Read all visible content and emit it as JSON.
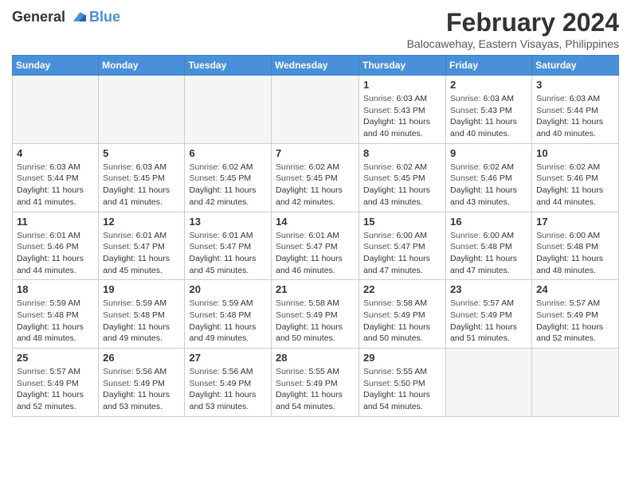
{
  "header": {
    "logo_general": "General",
    "logo_blue": "Blue",
    "month": "February 2024",
    "location": "Balocawehay, Eastern Visayas, Philippines"
  },
  "columns": [
    "Sunday",
    "Monday",
    "Tuesday",
    "Wednesday",
    "Thursday",
    "Friday",
    "Saturday"
  ],
  "weeks": [
    {
      "days": [
        {
          "num": "",
          "empty": true
        },
        {
          "num": "",
          "empty": true
        },
        {
          "num": "",
          "empty": true
        },
        {
          "num": "",
          "empty": true
        },
        {
          "num": "1",
          "sunrise": "6:03 AM",
          "sunset": "5:43 PM",
          "daylight": "11 hours and 40 minutes."
        },
        {
          "num": "2",
          "sunrise": "6:03 AM",
          "sunset": "5:43 PM",
          "daylight": "11 hours and 40 minutes."
        },
        {
          "num": "3",
          "sunrise": "6:03 AM",
          "sunset": "5:44 PM",
          "daylight": "11 hours and 40 minutes."
        }
      ]
    },
    {
      "days": [
        {
          "num": "4",
          "sunrise": "6:03 AM",
          "sunset": "5:44 PM",
          "daylight": "11 hours and 41 minutes."
        },
        {
          "num": "5",
          "sunrise": "6:03 AM",
          "sunset": "5:45 PM",
          "daylight": "11 hours and 41 minutes."
        },
        {
          "num": "6",
          "sunrise": "6:02 AM",
          "sunset": "5:45 PM",
          "daylight": "11 hours and 42 minutes."
        },
        {
          "num": "7",
          "sunrise": "6:02 AM",
          "sunset": "5:45 PM",
          "daylight": "11 hours and 42 minutes."
        },
        {
          "num": "8",
          "sunrise": "6:02 AM",
          "sunset": "5:45 PM",
          "daylight": "11 hours and 43 minutes."
        },
        {
          "num": "9",
          "sunrise": "6:02 AM",
          "sunset": "5:46 PM",
          "daylight": "11 hours and 43 minutes."
        },
        {
          "num": "10",
          "sunrise": "6:02 AM",
          "sunset": "5:46 PM",
          "daylight": "11 hours and 44 minutes."
        }
      ]
    },
    {
      "days": [
        {
          "num": "11",
          "sunrise": "6:01 AM",
          "sunset": "5:46 PM",
          "daylight": "11 hours and 44 minutes."
        },
        {
          "num": "12",
          "sunrise": "6:01 AM",
          "sunset": "5:47 PM",
          "daylight": "11 hours and 45 minutes."
        },
        {
          "num": "13",
          "sunrise": "6:01 AM",
          "sunset": "5:47 PM",
          "daylight": "11 hours and 45 minutes."
        },
        {
          "num": "14",
          "sunrise": "6:01 AM",
          "sunset": "5:47 PM",
          "daylight": "11 hours and 46 minutes."
        },
        {
          "num": "15",
          "sunrise": "6:00 AM",
          "sunset": "5:47 PM",
          "daylight": "11 hours and 47 minutes."
        },
        {
          "num": "16",
          "sunrise": "6:00 AM",
          "sunset": "5:48 PM",
          "daylight": "11 hours and 47 minutes."
        },
        {
          "num": "17",
          "sunrise": "6:00 AM",
          "sunset": "5:48 PM",
          "daylight": "11 hours and 48 minutes."
        }
      ]
    },
    {
      "days": [
        {
          "num": "18",
          "sunrise": "5:59 AM",
          "sunset": "5:48 PM",
          "daylight": "11 hours and 48 minutes."
        },
        {
          "num": "19",
          "sunrise": "5:59 AM",
          "sunset": "5:48 PM",
          "daylight": "11 hours and 49 minutes."
        },
        {
          "num": "20",
          "sunrise": "5:59 AM",
          "sunset": "5:48 PM",
          "daylight": "11 hours and 49 minutes."
        },
        {
          "num": "21",
          "sunrise": "5:58 AM",
          "sunset": "5:49 PM",
          "daylight": "11 hours and 50 minutes."
        },
        {
          "num": "22",
          "sunrise": "5:58 AM",
          "sunset": "5:49 PM",
          "daylight": "11 hours and 50 minutes."
        },
        {
          "num": "23",
          "sunrise": "5:57 AM",
          "sunset": "5:49 PM",
          "daylight": "11 hours and 51 minutes."
        },
        {
          "num": "24",
          "sunrise": "5:57 AM",
          "sunset": "5:49 PM",
          "daylight": "11 hours and 52 minutes."
        }
      ]
    },
    {
      "days": [
        {
          "num": "25",
          "sunrise": "5:57 AM",
          "sunset": "5:49 PM",
          "daylight": "11 hours and 52 minutes."
        },
        {
          "num": "26",
          "sunrise": "5:56 AM",
          "sunset": "5:49 PM",
          "daylight": "11 hours and 53 minutes."
        },
        {
          "num": "27",
          "sunrise": "5:56 AM",
          "sunset": "5:49 PM",
          "daylight": "11 hours and 53 minutes."
        },
        {
          "num": "28",
          "sunrise": "5:55 AM",
          "sunset": "5:49 PM",
          "daylight": "11 hours and 54 minutes."
        },
        {
          "num": "29",
          "sunrise": "5:55 AM",
          "sunset": "5:50 PM",
          "daylight": "11 hours and 54 minutes."
        },
        {
          "num": "",
          "empty": true
        },
        {
          "num": "",
          "empty": true
        }
      ]
    }
  ],
  "labels": {
    "sunrise": "Sunrise:",
    "sunset": "Sunset:",
    "daylight": "Daylight hours"
  }
}
